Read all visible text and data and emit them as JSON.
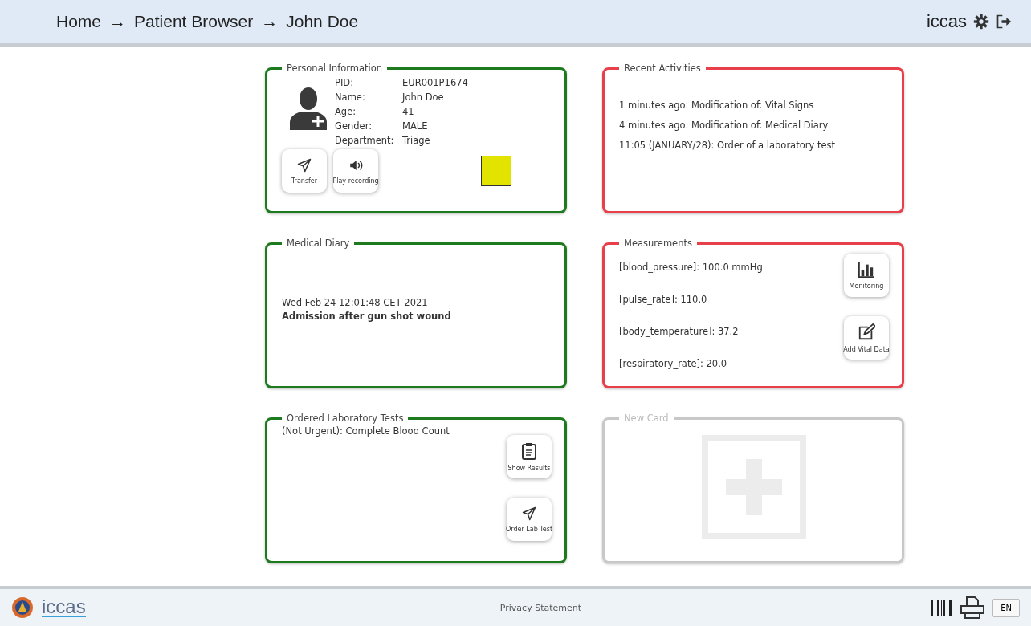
{
  "header": {
    "breadcrumb": [
      "Home",
      "Patient Browser",
      "John Doe"
    ],
    "separator": "→",
    "brand": "iccas"
  },
  "cards": [
    {
      "kind": "personal",
      "title": "Personal Information",
      "color": "#1e7a1e",
      "fields": [
        {
          "label": "PID:",
          "value": "EUR001P1674"
        },
        {
          "label": "Name:",
          "value": "John Doe"
        },
        {
          "label": "Age:",
          "value": "41"
        },
        {
          "label": "Gender:",
          "value": "MALE"
        },
        {
          "label": "Department:",
          "value": "Triage"
        }
      ],
      "buttons": [
        {
          "kind": "send",
          "label": "Transfer"
        },
        {
          "kind": "speaker",
          "label": "Play recording"
        }
      ],
      "markers": [
        {
          "kind": "triage",
          "color": "#e3e300"
        }
      ]
    },
    {
      "kind": "activities",
      "title": "Recent Activities",
      "color": "#e8404a",
      "lines": [
        "1 minutes ago: Modification of: Vital Signs",
        "4 minutes ago: Modification of: Medical Diary",
        "11:05 (JANUARY/28): Order of a laboratory test"
      ]
    },
    {
      "kind": "diary",
      "title": "Medical Diary",
      "color": "#1e7a1e",
      "date": "Wed Feb 24 12:01:48 CET 2021",
      "entry": "Admission after gun shot wound"
    },
    {
      "kind": "measurements",
      "title": "Measurements",
      "color": "#e8404a",
      "lines": [
        "[blood_pressure]: 100.0 mmHg",
        "[pulse_rate]: 110.0",
        "[body_temperature]: 37.2",
        "[respiratory_rate]: 20.0"
      ],
      "buttons": [
        {
          "kind": "chart",
          "label": "Monitoring"
        },
        {
          "kind": "edit",
          "label": "Add Vital Data"
        }
      ]
    },
    {
      "kind": "lab",
      "title": "Ordered Laboratory Tests",
      "color": "#1e7a1e",
      "lines": [
        "(Not Urgent): Complete Blood Count"
      ],
      "buttons": [
        {
          "kind": "clipboard",
          "label": "Show Results"
        },
        {
          "kind": "send",
          "label": "Order Lab Test"
        }
      ]
    },
    {
      "kind": "new",
      "title": "New Card",
      "color": "#c8c8c8"
    }
  ],
  "footer": {
    "logo": "iccas",
    "link": "Privacy Statement",
    "language": "EN"
  }
}
